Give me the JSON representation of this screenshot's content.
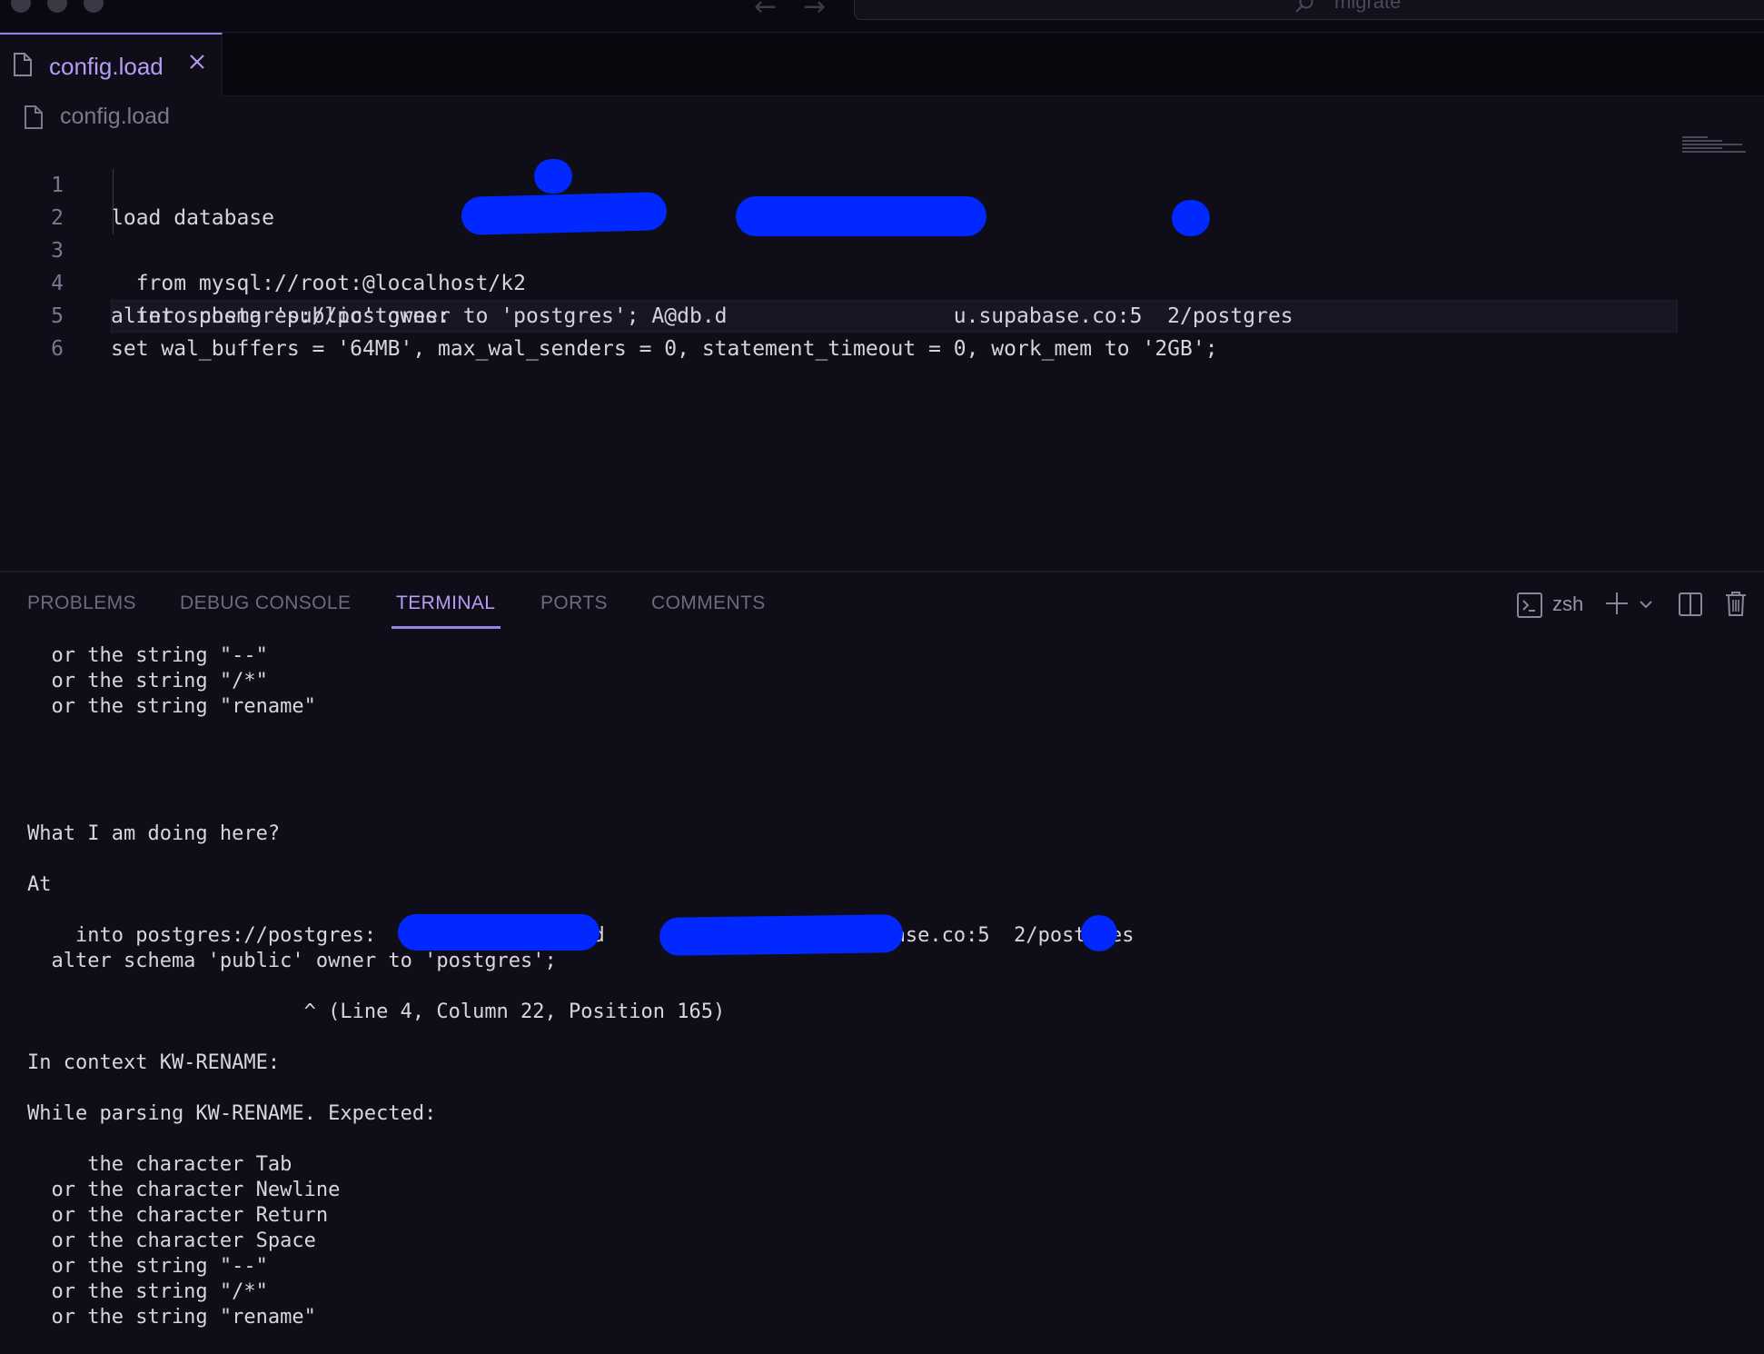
{
  "titlebar": {
    "search_text": "migrate"
  },
  "tab": {
    "label": "config.load"
  },
  "breadcrumb": {
    "label": "config.load"
  },
  "editor": {
    "lines": [
      {
        "num": "1",
        "text": "load database"
      },
      {
        "num": "2",
        "text": "  from mysql://root:@localhost/k2"
      },
      {
        "num": "3",
        "text": "  into postgres://postgres:                A@db.d                  u.supabase.co:5  2/postgres"
      },
      {
        "num": "4",
        "text": "alter schema 'public' owner to 'postgres';"
      },
      {
        "num": "5",
        "text": "set wal_buffers = '64MB', max_wal_senders = 0, statement_timeout = 0, work_mem to '2GB';"
      },
      {
        "num": "6",
        "text": ""
      }
    ]
  },
  "panel": {
    "tabs": [
      "Problems",
      "Debug Console",
      "Terminal",
      "Ports",
      "Comments"
    ],
    "active_tab": "Terminal",
    "shell_label": "zsh"
  },
  "terminal": {
    "lines": [
      "  or the string \"--\"",
      "  or the string \"/*\"",
      "  or the string \"rename\"",
      "",
      "",
      "",
      "",
      "What I am doing here?",
      "",
      "At",
      "",
      "    into postgres://postgres:              @db.d                  .supabase.co:5  2/postgres",
      "  alter schema 'public' owner to 'postgres';",
      "",
      "                       ^ (Line 4, Column 22, Position 165)",
      "",
      "In context KW-RENAME:",
      "",
      "While parsing KW-RENAME. Expected:",
      "",
      "     the character Tab",
      "  or the character Newline",
      "  or the character Return",
      "  or the character Space",
      "  or the string \"--\"",
      "  or the string \"/*\"",
      "  or the string \"rename\""
    ]
  },
  "colors": {
    "accent": "#9b82e8",
    "background": "#0f0d18",
    "redaction": "#0028ff"
  }
}
